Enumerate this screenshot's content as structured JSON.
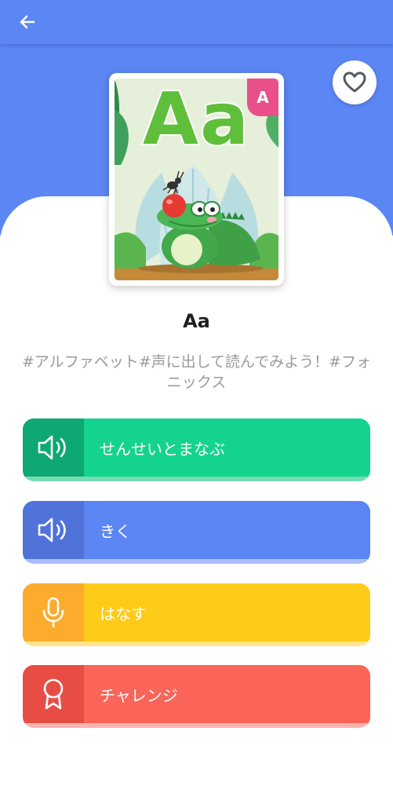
{
  "header": {
    "back_icon": "arrow-left-icon"
  },
  "favorite": {
    "icon": "heart-outline-icon"
  },
  "card": {
    "letters": "Aa",
    "badge": "A"
  },
  "title": "Aa",
  "tags": "#アルファベット#声に出して読んでみよう！#フォニックス",
  "actions": [
    {
      "label": "せんせいとまなぶ",
      "icon": "speaker-icon",
      "color": "#14d38f"
    },
    {
      "label": "きく",
      "icon": "speaker-icon",
      "color": "#5b86f4"
    },
    {
      "label": "はなす",
      "icon": "microphone-icon",
      "color": "#ffcb19"
    },
    {
      "label": "チャレンジ",
      "icon": "award-ribbon-icon",
      "color": "#fb6459"
    }
  ],
  "colors": {
    "header": "#5b86f4",
    "badge": "#e9508a",
    "letters": "#5fbf3a"
  }
}
